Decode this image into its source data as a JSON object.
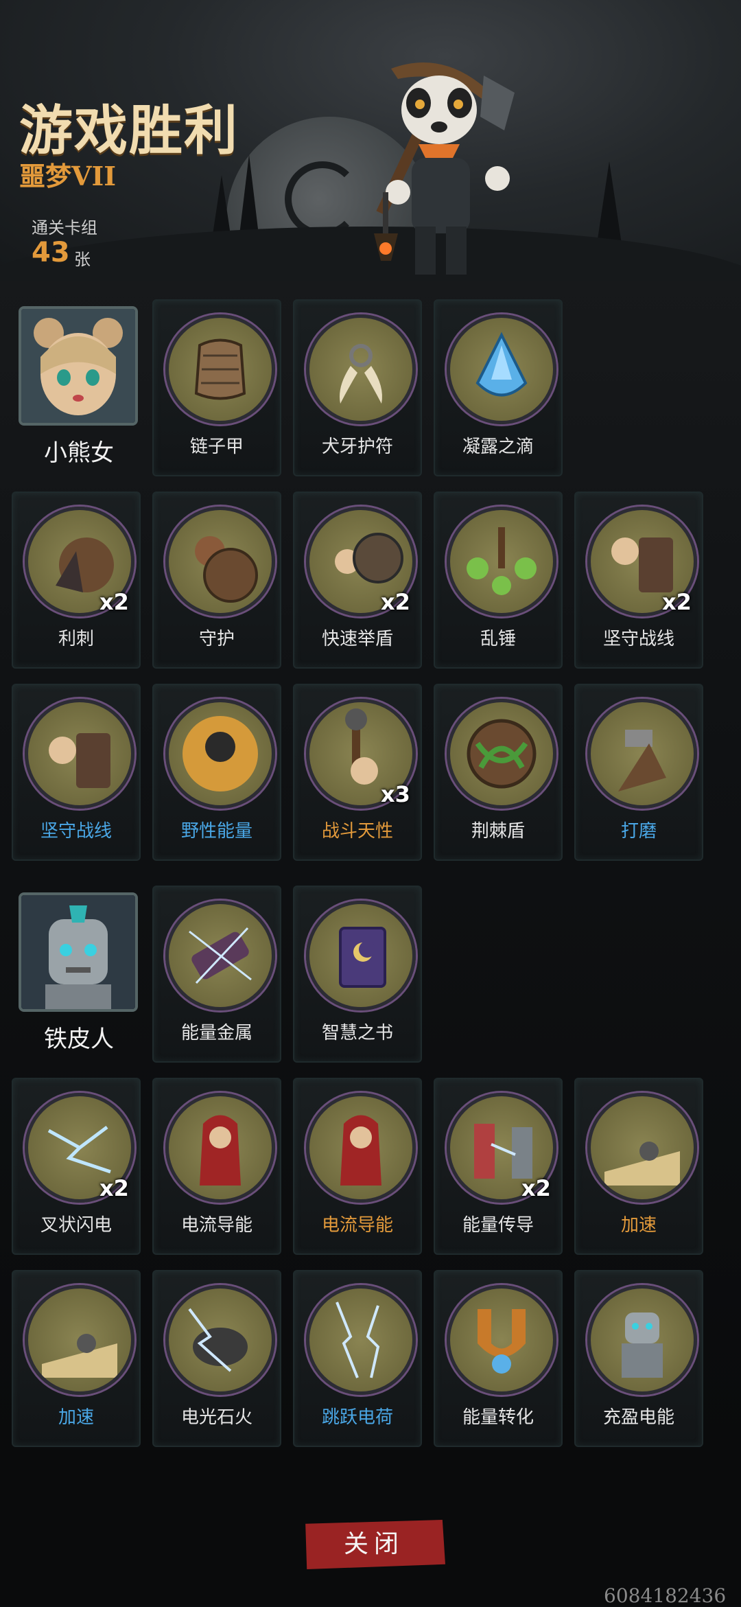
{
  "header": {
    "title": "游戏胜利",
    "difficulty": "噩梦VII",
    "deck_label": "通关卡组",
    "deck_count": "43",
    "deck_unit": "张"
  },
  "characters": [
    {
      "name": "小熊女",
      "relics": [
        "链子甲",
        "犬牙护符",
        "凝露之滴"
      ],
      "cards": [
        {
          "label": "利刺",
          "count": "x2",
          "color": "white"
        },
        {
          "label": "守护",
          "count": "",
          "color": "white"
        },
        {
          "label": "快速举盾",
          "count": "x2",
          "color": "white"
        },
        {
          "label": "乱锤",
          "count": "",
          "color": "white"
        },
        {
          "label": "坚守战线",
          "count": "x2",
          "color": "white"
        },
        {
          "label": "坚守战线",
          "count": "",
          "color": "blue"
        },
        {
          "label": "野性能量",
          "count": "",
          "color": "blue"
        },
        {
          "label": "战斗天性",
          "count": "x3",
          "color": "orange"
        },
        {
          "label": "荆棘盾",
          "count": "",
          "color": "white"
        },
        {
          "label": "打磨",
          "count": "",
          "color": "blue"
        }
      ]
    },
    {
      "name": "铁皮人",
      "relics": [
        "能量金属",
        "智慧之书"
      ],
      "cards": [
        {
          "label": "叉状闪电",
          "count": "x2",
          "color": "white"
        },
        {
          "label": "电流导能",
          "count": "",
          "color": "white"
        },
        {
          "label": "电流导能",
          "count": "",
          "color": "orange"
        },
        {
          "label": "能量传导",
          "count": "x2",
          "color": "white"
        },
        {
          "label": "加速",
          "count": "",
          "color": "orange"
        },
        {
          "label": "加速",
          "count": "",
          "color": "blue"
        },
        {
          "label": "电光石火",
          "count": "",
          "color": "white"
        },
        {
          "label": "跳跃电荷",
          "count": "",
          "color": "blue"
        },
        {
          "label": "能量转化",
          "count": "",
          "color": "white"
        },
        {
          "label": "充盈电能",
          "count": "",
          "color": "white"
        }
      ]
    }
  ],
  "close_button": "关闭",
  "watermark": "6084182436",
  "colors": {
    "blue_card": "#4aa7e6",
    "orange_card": "#e39a3b",
    "close_bg": "#9a2323"
  }
}
